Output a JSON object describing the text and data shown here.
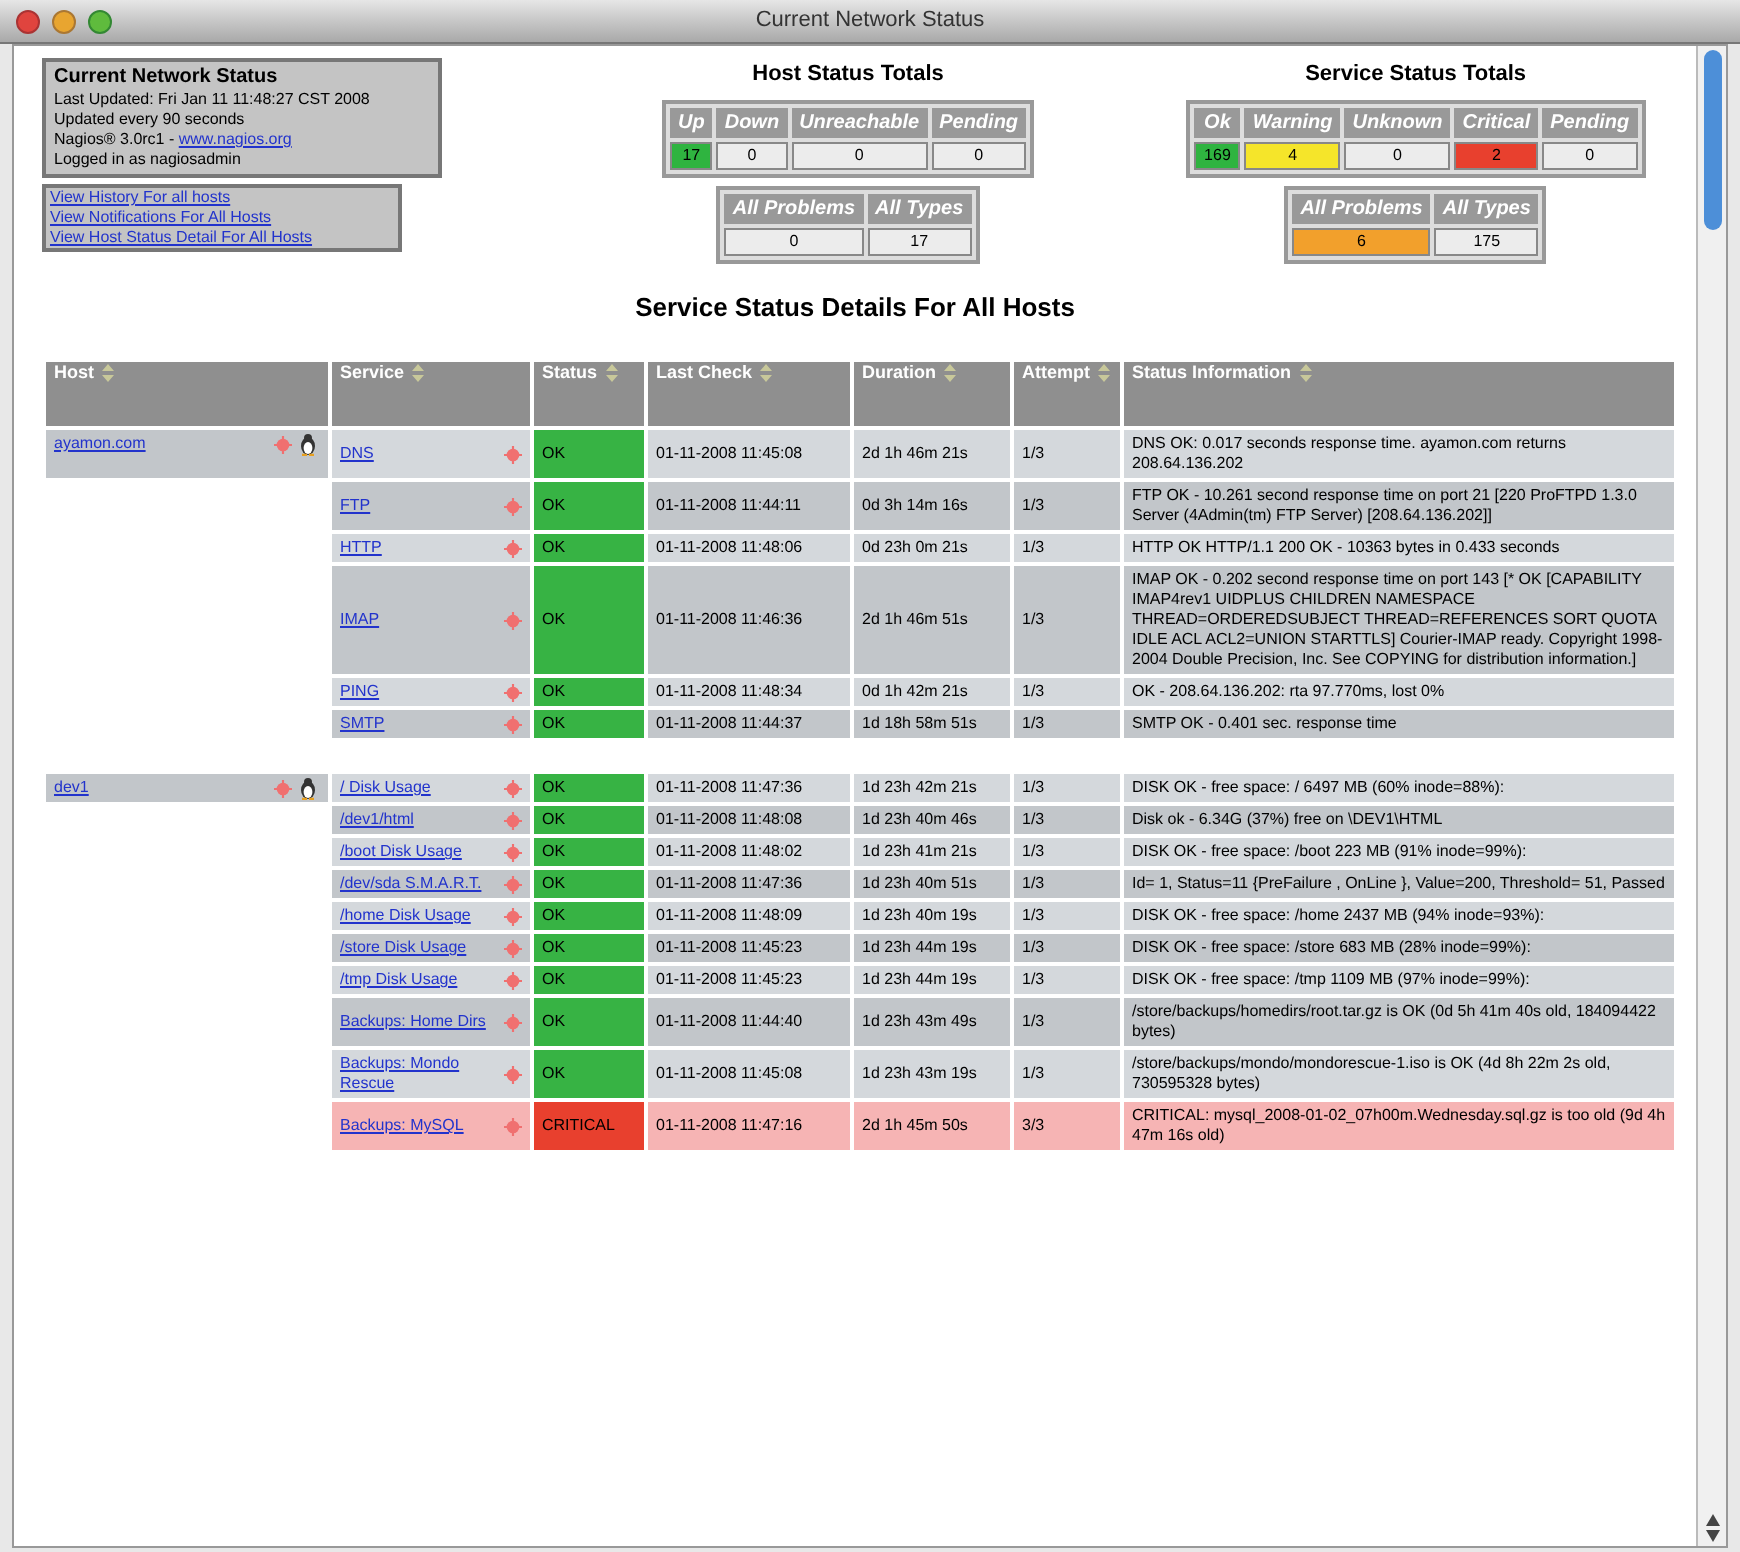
{
  "window": {
    "title": "Current Network Status"
  },
  "status_box": {
    "title": "Current Network Status",
    "lines": [
      "Last Updated: Fri Jan 11 11:48:27 CST 2008",
      "Updated every 90 seconds"
    ],
    "version": "Nagios® 3.0rc1 - ",
    "version_link": "www.nagios.org",
    "user": "Logged in as nagiosadmin"
  },
  "links": [
    "View History For all hosts",
    "View Notifications For All Hosts",
    "View Host Status Detail For All Hosts"
  ],
  "host_totals": {
    "title": "Host Status Totals",
    "cells": [
      {
        "label": "Up",
        "value": "17",
        "kind": "ok"
      },
      {
        "label": "Down",
        "value": "0",
        "kind": "plain"
      },
      {
        "label": "Unreachable",
        "value": "0",
        "kind": "plain"
      },
      {
        "label": "Pending",
        "value": "0",
        "kind": "plain"
      }
    ],
    "summary": [
      {
        "label": "All Problems",
        "value": "0",
        "kind": "plain"
      },
      {
        "label": "All Types",
        "value": "17",
        "kind": "plain"
      }
    ]
  },
  "service_totals": {
    "title": "Service Status Totals",
    "cells": [
      {
        "label": "Ok",
        "value": "169",
        "kind": "ok"
      },
      {
        "label": "Warning",
        "value": "4",
        "kind": "warning"
      },
      {
        "label": "Unknown",
        "value": "0",
        "kind": "plain"
      },
      {
        "label": "Critical",
        "value": "2",
        "kind": "critical"
      },
      {
        "label": "Pending",
        "value": "0",
        "kind": "plain"
      }
    ],
    "summary": [
      {
        "label": "All Problems",
        "value": "6",
        "kind": "problems"
      },
      {
        "label": "All Types",
        "value": "175",
        "kind": "plain"
      }
    ]
  },
  "heading": "Service Status Details For All Hosts",
  "table": {
    "columns": [
      "Host",
      "Service",
      "Status",
      "Last Check",
      "Duration",
      "Attempt",
      "Status Information"
    ],
    "hosts": [
      {
        "name": "ayamon.com",
        "services": [
          {
            "name": "DNS",
            "status": "OK",
            "kind": "ok",
            "last_check": "01-11-2008 11:45:08",
            "duration": "2d 1h 46m 21s",
            "attempt": "1/3",
            "info": "DNS OK: 0.017 seconds response time. ayamon.com returns 208.64.136.202"
          },
          {
            "name": "FTP",
            "status": "OK",
            "kind": "ok",
            "last_check": "01-11-2008 11:44:11",
            "duration": "0d 3h 14m 16s",
            "attempt": "1/3",
            "info": "FTP OK - 10.261 second response time on port 21 [220 ProFTPD 1.3.0 Server (4Admin(tm) FTP Server) [208.64.136.202]]"
          },
          {
            "name": "HTTP",
            "status": "OK",
            "kind": "ok",
            "last_check": "01-11-2008 11:48:06",
            "duration": "0d 23h 0m 21s",
            "attempt": "1/3",
            "info": "HTTP OK HTTP/1.1 200 OK - 10363 bytes in 0.433 seconds"
          },
          {
            "name": "IMAP",
            "status": "OK",
            "kind": "ok",
            "last_check": "01-11-2008 11:46:36",
            "duration": "2d 1h 46m 51s",
            "attempt": "1/3",
            "info": "IMAP OK - 0.202 second response time on port 143 [* OK [CAPABILITY IMAP4rev1 UIDPLUS CHILDREN NAMESPACE THREAD=ORDEREDSUBJECT THREAD=REFERENCES SORT QUOTA IDLE ACL ACL2=UNION STARTTLS] Courier-IMAP ready. Copyright 1998-2004 Double Precision, Inc. See COPYING for distribution information.]"
          },
          {
            "name": "PING",
            "status": "OK",
            "kind": "ok",
            "last_check": "01-11-2008 11:48:34",
            "duration": "0d 1h 42m 21s",
            "attempt": "1/3",
            "info": "OK - 208.64.136.202: rta 97.770ms, lost 0%"
          },
          {
            "name": "SMTP",
            "status": "OK",
            "kind": "ok",
            "last_check": "01-11-2008 11:44:37",
            "duration": "1d 18h 58m 51s",
            "attempt": "1/3",
            "info": "SMTP OK - 0.401 sec. response time"
          }
        ]
      },
      {
        "name": "dev1",
        "services": [
          {
            "name": "/ Disk Usage",
            "status": "OK",
            "kind": "ok",
            "last_check": "01-11-2008 11:47:36",
            "duration": "1d 23h 42m 21s",
            "attempt": "1/3",
            "info": "DISK OK - free space: / 6497 MB (60% inode=88%):"
          },
          {
            "name": "/dev1/html",
            "status": "OK",
            "kind": "ok",
            "last_check": "01-11-2008 11:48:08",
            "duration": "1d 23h 40m 46s",
            "attempt": "1/3",
            "info": "Disk ok - 6.34G (37%) free on \\DEV1\\HTML"
          },
          {
            "name": "/boot Disk Usage",
            "status": "OK",
            "kind": "ok",
            "last_check": "01-11-2008 11:48:02",
            "duration": "1d 23h 41m 21s",
            "attempt": "1/3",
            "info": "DISK OK - free space: /boot 223 MB (91% inode=99%):"
          },
          {
            "name": "/dev/sda S.M.A.R.T.",
            "status": "OK",
            "kind": "ok",
            "last_check": "01-11-2008 11:47:36",
            "duration": "1d 23h 40m 51s",
            "attempt": "1/3",
            "info": "Id= 1, Status=11 {PreFailure , OnLine }, Value=200, Threshold= 51, Passed"
          },
          {
            "name": "/home Disk Usage",
            "status": "OK",
            "kind": "ok",
            "last_check": "01-11-2008 11:48:09",
            "duration": "1d 23h 40m 19s",
            "attempt": "1/3",
            "info": "DISK OK - free space: /home 2437 MB (94% inode=93%):"
          },
          {
            "name": "/store Disk Usage",
            "status": "OK",
            "kind": "ok",
            "last_check": "01-11-2008 11:45:23",
            "duration": "1d 23h 44m 19s",
            "attempt": "1/3",
            "info": "DISK OK - free space: /store 683 MB (28% inode=99%):"
          },
          {
            "name": "/tmp Disk Usage",
            "status": "OK",
            "kind": "ok",
            "last_check": "01-11-2008 11:45:23",
            "duration": "1d 23h 44m 19s",
            "attempt": "1/3",
            "info": "DISK OK - free space: /tmp 1109 MB (97% inode=99%):"
          },
          {
            "name": "Backups: Home Dirs",
            "status": "OK",
            "kind": "ok",
            "last_check": "01-11-2008 11:44:40",
            "duration": "1d 23h 43m 49s",
            "attempt": "1/3",
            "info": "/store/backups/homedirs/root.tar.gz is OK (0d 5h 41m 40s old, 184094422 bytes)"
          },
          {
            "name": "Backups: Mondo Rescue",
            "status": "OK",
            "kind": "ok",
            "last_check": "01-11-2008 11:45:08",
            "duration": "1d 23h 43m 19s",
            "attempt": "1/3",
            "info": "/store/backups/mondo/mondorescue-1.iso is OK (4d 8h 22m 2s old, 730595328 bytes)"
          },
          {
            "name": "Backups: MySQL",
            "status": "CRITICAL",
            "kind": "critical",
            "last_check": "01-11-2008 11:47:16",
            "duration": "2d 1h 45m 50s",
            "attempt": "3/3",
            "info": "CRITICAL: mysql_2008-01-02_07h00m.Wednesday.sql.gz is too old (9d 4h 47m 16s old)"
          }
        ]
      }
    ]
  }
}
